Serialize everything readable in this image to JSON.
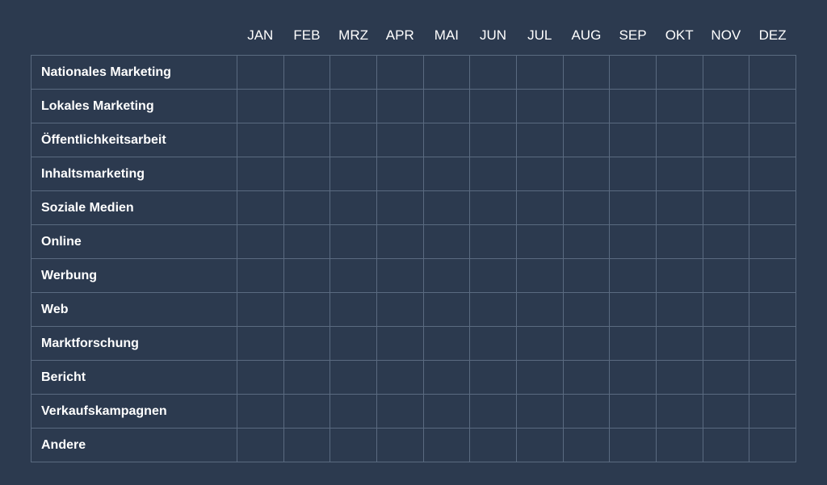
{
  "months": [
    "JAN",
    "FEB",
    "MRZ",
    "APR",
    "MAI",
    "JUN",
    "JUL",
    "AUG",
    "SEP",
    "OKT",
    "NOV",
    "DEZ"
  ],
  "rows": [
    "Nationales Marketing",
    "Lokales Marketing",
    "Öffentlichkeitsarbeit",
    "Inhaltsmarketing",
    "Soziale Medien",
    "Online",
    "Werbung",
    "Web",
    "Marktforschung",
    "Bericht",
    "Verkaufskampagnen",
    "Andere"
  ]
}
